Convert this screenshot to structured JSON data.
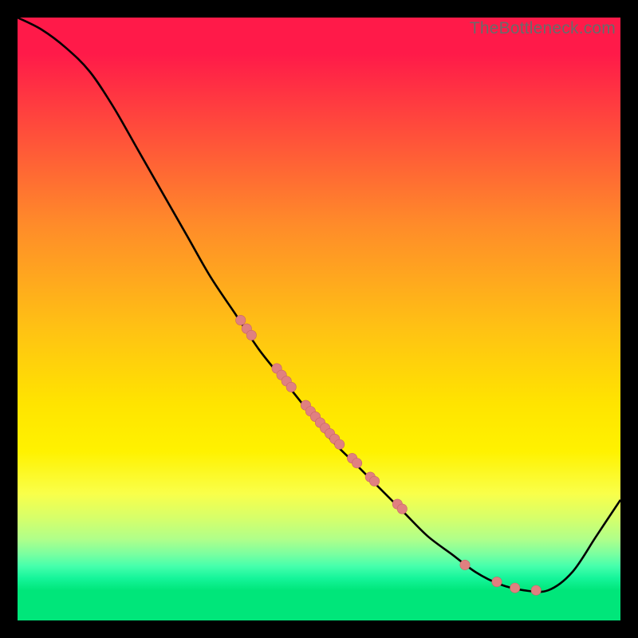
{
  "watermark": "TheBottleneck.com",
  "colors": {
    "gradient_top": "#ff1a49",
    "gradient_bottom": "#00e67a",
    "curve": "#000000",
    "dot_fill": "#e08080",
    "dot_stroke": "#c86666"
  },
  "chart_data": {
    "type": "line",
    "title": "",
    "xlabel": "",
    "ylabel": "",
    "xlim": [
      0,
      100
    ],
    "ylim": [
      0,
      100
    ],
    "note": "Axes are implicit (no tick labels). Values are read as percentages of plot width/height; y is plotted top-down (0 = top edge, 100 = bottom). Curve descends from top-left, flattens near bottom-right valley around x≈84, then rises toward the right edge.",
    "series": [
      {
        "name": "curve",
        "x": [
          0,
          4,
          8,
          12,
          16,
          20,
          24,
          28,
          32,
          36,
          40,
          44,
          48,
          52,
          56,
          60,
          64,
          68,
          72,
          76,
          80,
          84,
          88,
          92,
          96,
          100
        ],
        "y": [
          0,
          2,
          5,
          9,
          15,
          22,
          29,
          36,
          43,
          49,
          55,
          60,
          65,
          70,
          74,
          78,
          82,
          86,
          89,
          92,
          94,
          95,
          95,
          92,
          86,
          80
        ]
      }
    ],
    "dots": {
      "name": "highlighted-points",
      "x": [
        37.0,
        38.0,
        38.8,
        43.0,
        43.8,
        44.6,
        45.4,
        47.8,
        48.6,
        49.4,
        50.2,
        51.0,
        51.8,
        52.6,
        53.4,
        55.5,
        56.3,
        58.5,
        59.2,
        63.0,
        63.8,
        74.2,
        79.5,
        82.5,
        86.0
      ],
      "y": [
        50.2,
        51.6,
        52.7,
        58.2,
        59.3,
        60.3,
        61.3,
        64.3,
        65.3,
        66.2,
        67.2,
        68.1,
        69.0,
        69.9,
        70.8,
        73.1,
        73.9,
        76.2,
        76.9,
        80.7,
        81.5,
        90.8,
        93.6,
        94.6,
        95.0
      ]
    }
  }
}
